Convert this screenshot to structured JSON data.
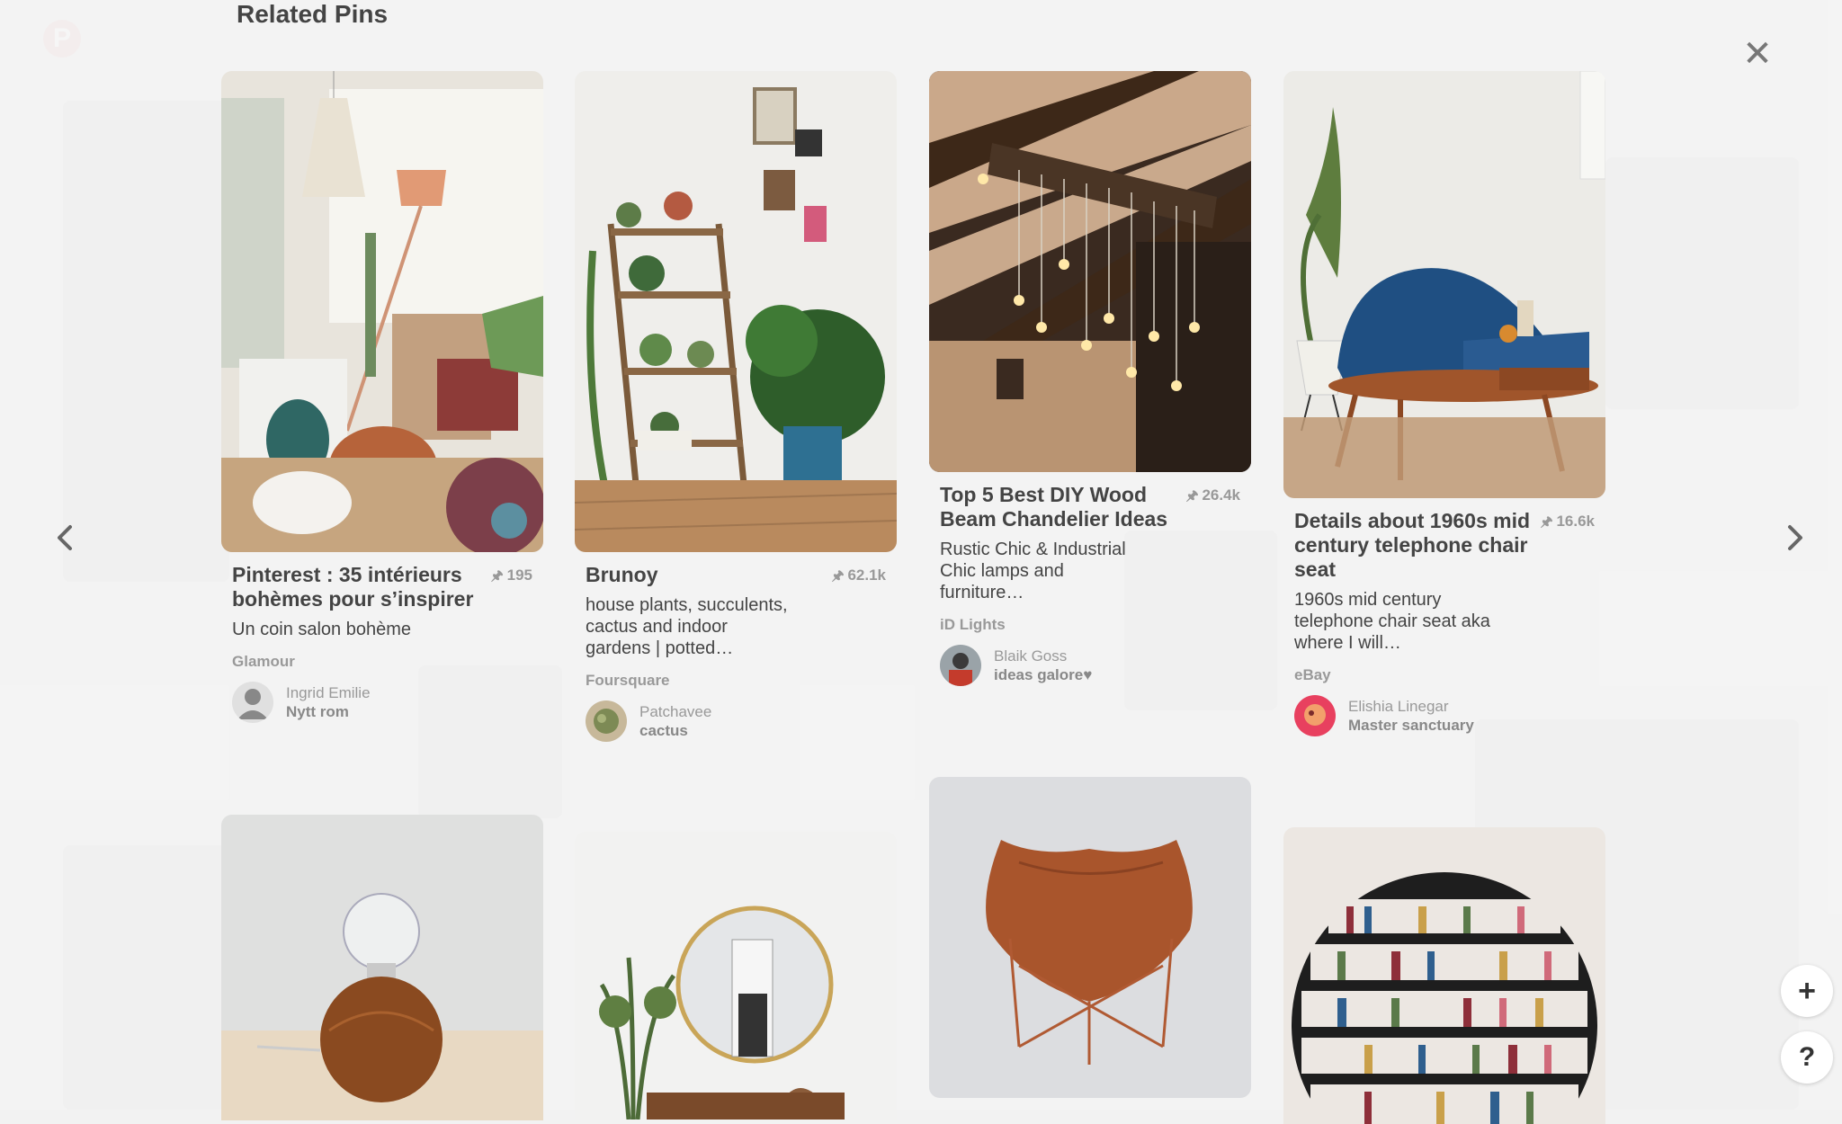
{
  "modal": {
    "heading": "Related Pins"
  },
  "icons": {
    "close": "close-icon",
    "prev": "chevron-left-icon",
    "next": "chevron-right-icon",
    "pin": "pin-icon",
    "add": "plus-icon",
    "help": "question-icon"
  },
  "pins": [
    {
      "title": "Pinterest : 35 intérieurs bohèmes pour s’inspirer",
      "saves": "195",
      "description": "Un coin salon bohème",
      "source": "Glamour",
      "author_name": "Ingrid Emilie",
      "board": "Nytt rom"
    },
    {
      "title": "Brunoy",
      "saves": "62.1k",
      "description": "house plants, succulents, cactus and indoor gardens | potted…",
      "source": "Foursquare",
      "author_name": "Patchavee",
      "board": "cactus"
    },
    {
      "title": "Top 5 Best DIY Wood Beam Chandelier Ideas",
      "saves": "26.4k",
      "description": "Rustic Chic & Industrial Chic lamps and furniture…",
      "source": "iD Lights",
      "author_name": "Blaik Goss",
      "board": "ideas galore♥"
    },
    {
      "title": "Details about 1960s mid century telephone chair seat",
      "saves": "16.6k",
      "description": "1960s mid century telephone chair seat aka where I will…",
      "source": "eBay",
      "author_name": "Elishia Linegar",
      "board": "Master sanctuary"
    }
  ],
  "pin_glyph": "🖈",
  "fab": {
    "add": "+",
    "help": "?"
  },
  "close_glyph": "✕"
}
